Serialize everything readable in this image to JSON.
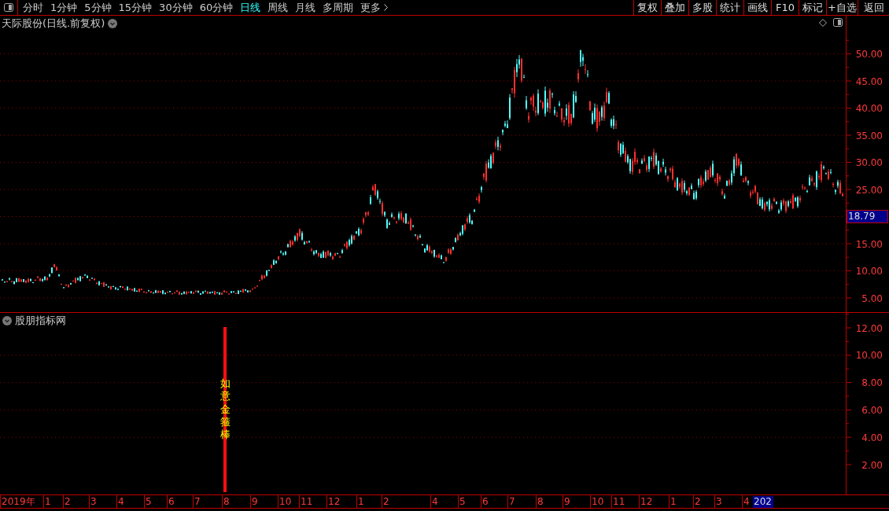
{
  "toolbar": {
    "periods": [
      {
        "label": "分时",
        "selected": false
      },
      {
        "label": "1分钟",
        "selected": false
      },
      {
        "label": "5分钟",
        "selected": false
      },
      {
        "label": "15分钟",
        "selected": false
      },
      {
        "label": "30分钟",
        "selected": false
      },
      {
        "label": "60分钟",
        "selected": false
      },
      {
        "label": "日线",
        "selected": true
      },
      {
        "label": "周线",
        "selected": false
      },
      {
        "label": "月线",
        "selected": false
      },
      {
        "label": "多周期",
        "selected": false
      },
      {
        "label": "更多",
        "selected": false
      }
    ],
    "actions": [
      "复权",
      "叠加",
      "多股",
      "统计",
      "画线",
      "F10",
      "标记",
      "+自选",
      "返回"
    ]
  },
  "price_panel": {
    "title": "天际股份(日线.前复权)",
    "axis_labels": [
      "50.00",
      "45.00",
      "40.00",
      "35.00",
      "30.00",
      "25.00",
      "15.00",
      "10.00",
      "5.00"
    ],
    "last_price": "18.79"
  },
  "indicator_panel": {
    "title": "股朋指标网",
    "axis_labels": [
      "12.00",
      "10.00",
      "8.00",
      "6.00",
      "4.00",
      "2.00"
    ],
    "signal_label": "如意金箍棒"
  },
  "time_axis": {
    "labels": [
      "2019年",
      "1",
      "2",
      "3",
      "4",
      "5",
      "6",
      "7",
      "8",
      "9",
      "10",
      "11",
      "12",
      "1",
      "2",
      "4",
      "5",
      "6",
      "7",
      "8",
      "9",
      "10",
      "11",
      "12",
      "1",
      "2",
      "3",
      "4"
    ],
    "highlighted_label": "202"
  }
}
